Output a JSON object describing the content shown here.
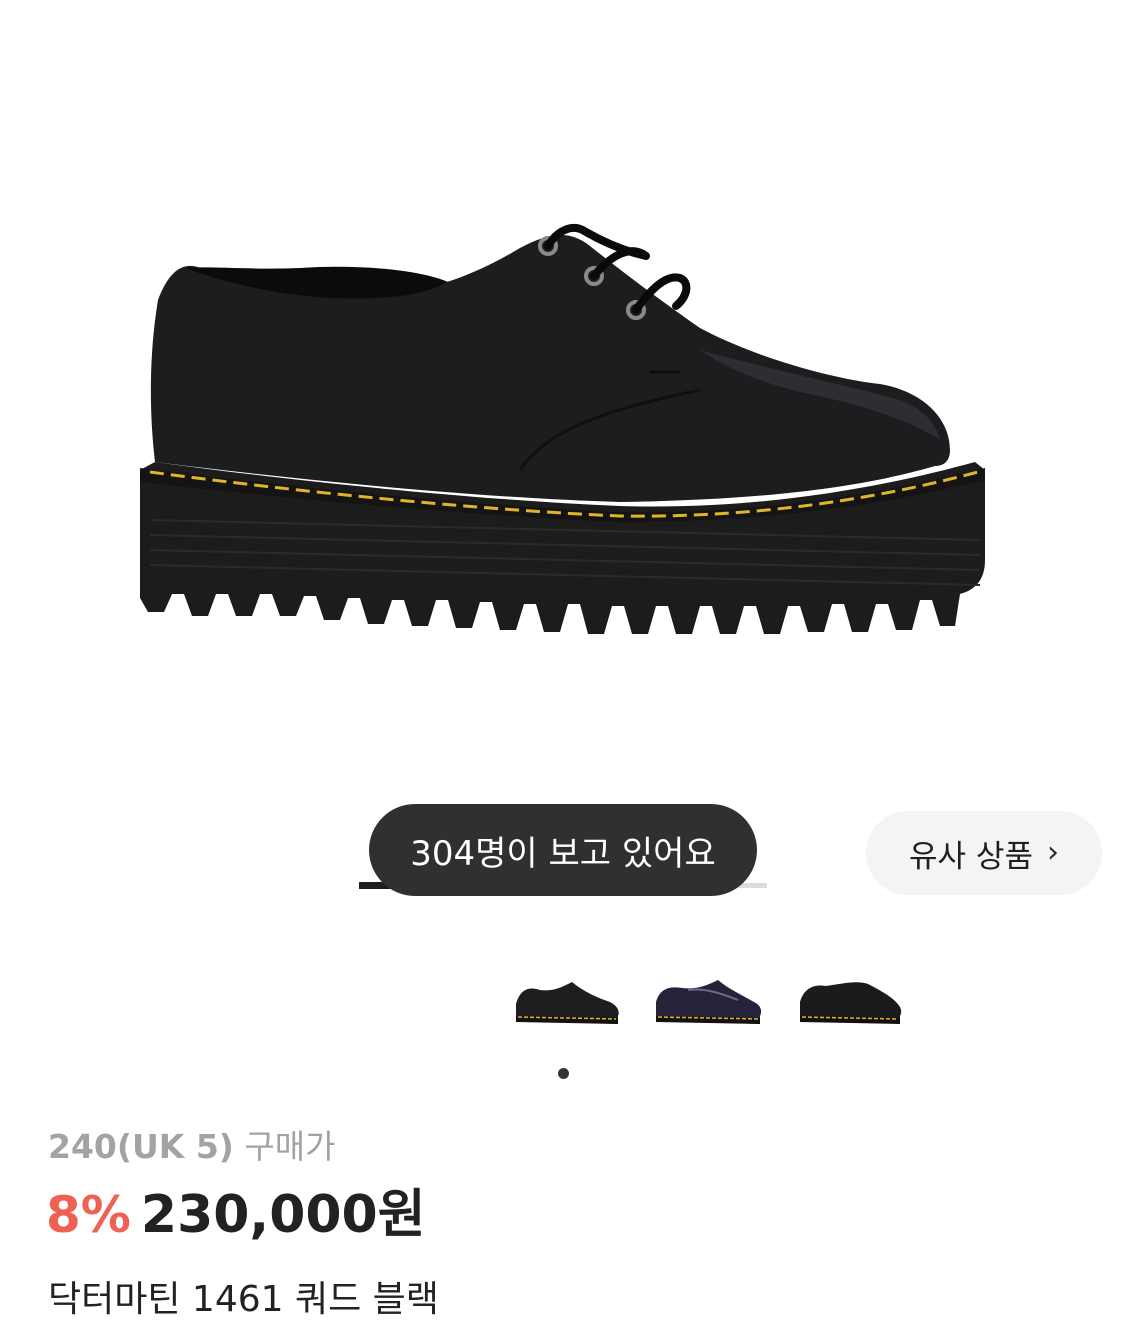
{
  "hero": {
    "image_alt": "black platform derby shoe with yellow stitching"
  },
  "viewers_badge": {
    "text": "304명이 보고 있어요"
  },
  "gallery": {
    "current_index": 1,
    "total": 9
  },
  "similar_button": {
    "label": "유사 상품",
    "icon": "chevron-right-icon"
  },
  "thumbnails": [
    {
      "name": "black-smooth"
    },
    {
      "name": "navy-polished"
    },
    {
      "name": "black-slip-on"
    }
  ],
  "product": {
    "size": "240(UK 5)",
    "price_type": "구매가",
    "discount": "8%",
    "price": "230,000원",
    "name": "닥터마틴 1461 쿼드 블랙"
  },
  "colors": {
    "discount": "#ef6253",
    "text": "#222222",
    "muted": "#a3a3a3",
    "pill_bg": "#2f3030",
    "button_bg": "#f4f4f4",
    "stitch": "#e0b52a"
  }
}
